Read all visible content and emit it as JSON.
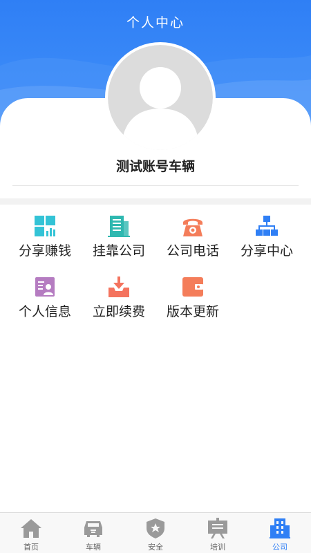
{
  "header": {
    "title": "个人中心"
  },
  "profile": {
    "username": "测试账号车辆"
  },
  "menu": {
    "items": [
      {
        "label": "分享赚钱",
        "icon": "chart-grid-icon",
        "color": "#33c3d6"
      },
      {
        "label": "挂靠公司",
        "icon": "building-icon",
        "color": "#2fb8b0"
      },
      {
        "label": "公司电话",
        "icon": "telephone-icon",
        "color": "#f47d5a"
      },
      {
        "label": "分享中心",
        "icon": "org-chart-icon",
        "color": "#2f7ff5"
      },
      {
        "label": "个人信息",
        "icon": "profile-card-icon",
        "color": "#b57cc1"
      },
      {
        "label": "立即续费",
        "icon": "download-tray-icon",
        "color": "#f4735e"
      },
      {
        "label": "版本更新",
        "icon": "wallet-icon",
        "color": "#f47d5a"
      }
    ]
  },
  "tabbar": {
    "active": "公司",
    "items": [
      {
        "label": "首页",
        "icon": "home-icon"
      },
      {
        "label": "车辆",
        "icon": "car-icon"
      },
      {
        "label": "安全",
        "icon": "shield-star-icon"
      },
      {
        "label": "培训",
        "icon": "training-board-icon"
      },
      {
        "label": "公司",
        "icon": "company-building-icon"
      }
    ],
    "inactive_color": "#9a9a9a",
    "active_color": "#2f7ff5"
  }
}
